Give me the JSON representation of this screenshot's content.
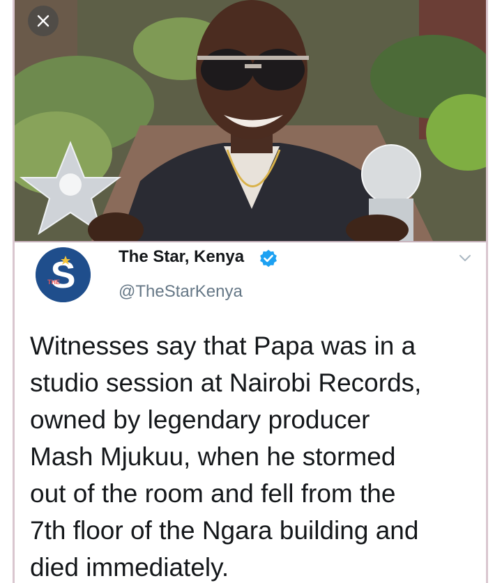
{
  "photo": {
    "description_icon": "photo",
    "close_icon": "close-icon"
  },
  "tweet": {
    "display_name": "The Star, Kenya",
    "handle": "@TheStarKenya",
    "verified_icon": "verified-badge-icon",
    "menu_icon": "chevron-down-icon",
    "avatar_letter": "S",
    "avatar_small_text": "THE",
    "text_lines": [
      "Witnesses say that Papa was in a",
      "studio session at Nairobi Records,",
      "owned by legendary producer",
      "Mash Mjukuu, when he stormed",
      "out of the room and fell from the",
      "7th floor of the Ngara building and",
      "died immediately."
    ]
  },
  "colors": {
    "verified_blue": "#1da1f2",
    "handle_gray": "#657786",
    "avatar_blue": "#1f4e8c"
  }
}
